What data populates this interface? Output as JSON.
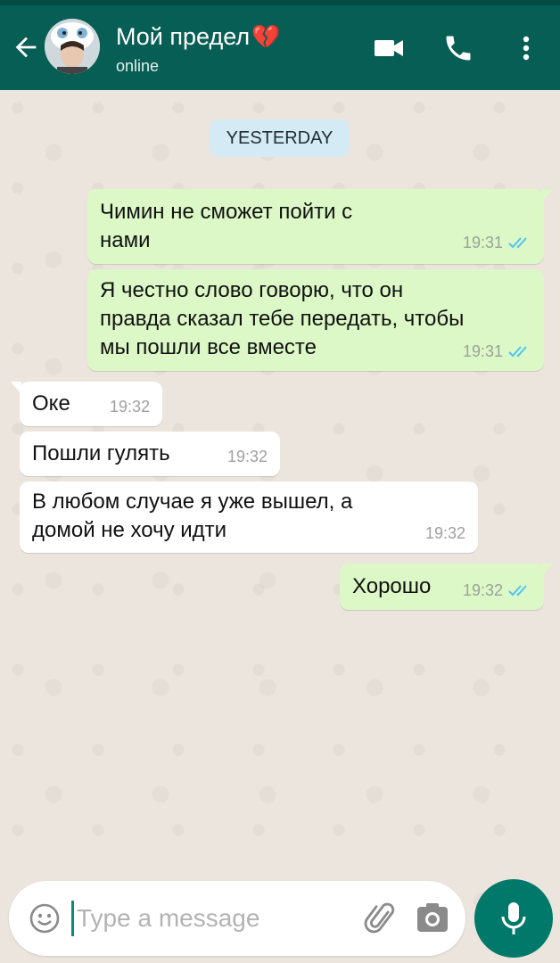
{
  "header": {
    "contact_name": "Мой предел",
    "name_emoji": "💔",
    "status": "online",
    "icons": [
      "back-arrow-icon",
      "video-call-icon",
      "phone-call-icon",
      "more-options-icon"
    ],
    "bg_color": "#075e54"
  },
  "chat": {
    "date_label": "YESTERDAY",
    "messages": [
      {
        "direction": "out",
        "text_lines": [
          "Чимин не сможет пойти с",
          "нами"
        ],
        "time": "19:31",
        "read": true
      },
      {
        "direction": "out",
        "text_lines": [
          "Я честно слово говорю, что он",
          "правда сказал тебе передать, чтобы",
          "мы пошли все вместе"
        ],
        "time": "19:31",
        "read": true
      },
      {
        "direction": "in",
        "text_lines": [
          "Оке"
        ],
        "time": "19:32"
      },
      {
        "direction": "in",
        "text_lines": [
          "Пошли гулять"
        ],
        "time": "19:32"
      },
      {
        "direction": "in",
        "text_lines": [
          "В любом случае я уже вышел, а",
          "домой не хочу идти"
        ],
        "time": "19:32"
      },
      {
        "direction": "out",
        "text_lines": [
          "Хорошо"
        ],
        "time": "19:32",
        "read": true
      }
    ]
  },
  "composer": {
    "placeholder": "Type a message",
    "value": "",
    "icons": [
      "emoji-icon",
      "attach-icon",
      "camera-icon",
      "mic-icon"
    ],
    "accent": "#00796b"
  },
  "colors": {
    "outgoing_bubble": "#dcf8c6",
    "incoming_bubble": "#ffffff",
    "read_tick": "#4fc3f7"
  }
}
